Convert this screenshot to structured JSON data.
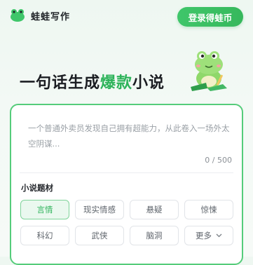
{
  "header": {
    "brand": "蛙蛙写作",
    "login_button": "登录得蛙币"
  },
  "hero": {
    "headline_pre": "一句话生成",
    "headline_highlight": "爆款",
    "headline_post": "小说"
  },
  "editor": {
    "placeholder": "一个普通外卖员发现自己拥有超能力，从此卷入一场外太空阴谋...",
    "counter": "0 / 500"
  },
  "genre": {
    "title": "小说题材",
    "options": [
      "言情",
      "现实情感",
      "悬疑",
      "惊悚",
      "科幻",
      "武侠",
      "脑洞"
    ],
    "selected": "言情",
    "more_label": "更多"
  },
  "colors": {
    "accent": "#2db35a",
    "button_green": "#3fc66a",
    "card_border": "#55cc7a"
  }
}
